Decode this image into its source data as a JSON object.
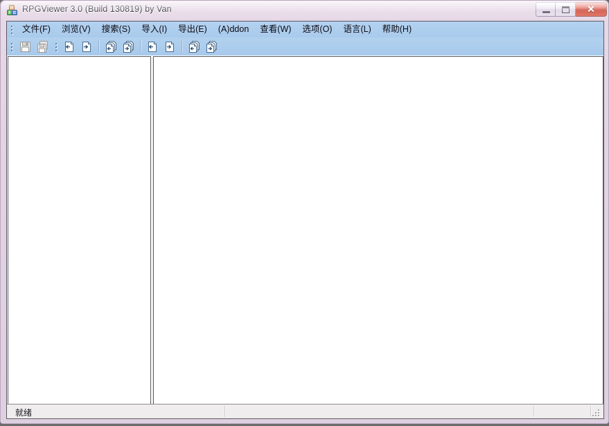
{
  "window": {
    "title": "RPGViewer 3.0 (Build 130819) by Van",
    "app_icon": "alphabet-blocks-icon",
    "controls": {
      "minimize": "─",
      "maximize": "□",
      "close": "✕"
    },
    "colors": {
      "frame": "#e2d3e3",
      "menubar": "#a9caec",
      "client": "#ffffff",
      "statusbar": "#efedee",
      "close_button": "#c73d2e"
    }
  },
  "menubar": {
    "grip": "drag-grip-icon",
    "items": [
      {
        "label": "文件(F)",
        "name": "menu-file"
      },
      {
        "label": "浏览(V)",
        "name": "menu-browse"
      },
      {
        "label": "搜索(S)",
        "name": "menu-search"
      },
      {
        "label": "导入(I)",
        "name": "menu-import"
      },
      {
        "label": "导出(E)",
        "name": "menu-export"
      },
      {
        "label": "(A)ddon",
        "name": "menu-addon"
      },
      {
        "label": "查看(W)",
        "name": "menu-view"
      },
      {
        "label": "选项(O)",
        "name": "menu-options"
      },
      {
        "label": "语言(L)",
        "name": "menu-language"
      },
      {
        "label": "帮助(H)",
        "name": "menu-help"
      }
    ]
  },
  "toolbar": {
    "grip": "drag-grip-icon",
    "groups": [
      {
        "name": "file-group",
        "buttons": [
          {
            "name": "save-button",
            "icon": "floppy-disk-icon",
            "disabled": true
          },
          {
            "name": "save-all-button",
            "icon": "floppy-disk-stack-icon",
            "disabled": true
          }
        ]
      },
      {
        "name": "transfer-group-one",
        "buttons": [
          {
            "name": "import-page-button",
            "icon": "page-arrow-left-icon",
            "disabled": false
          },
          {
            "name": "export-page-button",
            "icon": "page-arrow-right-icon",
            "disabled": false
          },
          {
            "name": "import-pages-button",
            "icon": "pages-arrow-left-icon",
            "disabled": false
          },
          {
            "name": "export-pages-button",
            "icon": "pages-arrow-right-icon",
            "disabled": false
          }
        ]
      },
      {
        "name": "transfer-group-two",
        "buttons": [
          {
            "name": "import-page-alt-button",
            "icon": "page-arrow-left-icon",
            "disabled": false
          },
          {
            "name": "export-page-alt-button",
            "icon": "page-arrow-right-icon",
            "disabled": false
          },
          {
            "name": "import-pages-alt-button",
            "icon": "pages-arrow-left-icon",
            "disabled": false
          },
          {
            "name": "export-pages-alt-button",
            "icon": "pages-arrow-right-icon",
            "disabled": false
          }
        ]
      }
    ]
  },
  "panes": {
    "left": {
      "name": "tree-pane",
      "content": ""
    },
    "right": {
      "name": "content-pane",
      "content": ""
    },
    "splitter": "pane-splitter"
  },
  "statusbar": {
    "message": "就绪",
    "panels": [
      "",
      "",
      ""
    ],
    "resize_grip": "resize-grip-icon"
  }
}
